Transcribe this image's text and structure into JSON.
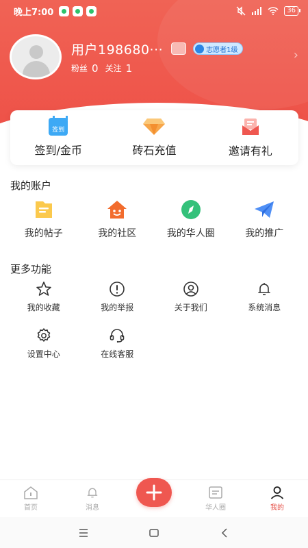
{
  "status_bar": {
    "time": "晚上7:00",
    "battery": "36"
  },
  "profile": {
    "username": "用户198680···",
    "volunteer_badge": "志愿者1级",
    "fans_label": "粉丝",
    "fans_count": "0",
    "follow_label": "关注",
    "follow_count": "1"
  },
  "quick_actions": [
    {
      "label": "签到/金币",
      "icon": "checkin-calendar-icon",
      "icon_text": "签到"
    },
    {
      "label": "砖石充值",
      "icon": "diamond-icon"
    },
    {
      "label": "邀请有礼",
      "icon": "invite-envelope-icon"
    }
  ],
  "my_account": {
    "title": "我的账户",
    "items": [
      {
        "label": "我的帖子",
        "icon": "post-folder-icon"
      },
      {
        "label": "我的社区",
        "icon": "community-house-icon"
      },
      {
        "label": "我的华人圈",
        "icon": "compass-icon"
      },
      {
        "label": "我的推广",
        "icon": "paper-plane-icon"
      }
    ]
  },
  "more_features": {
    "title": "更多功能",
    "items": [
      {
        "label": "我的收藏",
        "icon": "star-icon"
      },
      {
        "label": "我的举报",
        "icon": "alert-circle-icon"
      },
      {
        "label": "关于我们",
        "icon": "user-circle-icon"
      },
      {
        "label": "系统消息",
        "icon": "bell-icon"
      },
      {
        "label": "设置中心",
        "icon": "gear-icon"
      },
      {
        "label": "在线客服",
        "icon": "headset-icon"
      }
    ]
  },
  "bottom_nav": {
    "items": [
      {
        "label": "首页",
        "icon": "home-icon",
        "active": false
      },
      {
        "label": "消息",
        "icon": "bell-icon",
        "active": false
      },
      {
        "label": "",
        "icon": "plus-icon",
        "active": false
      },
      {
        "label": "华人圈",
        "icon": "message-square-icon",
        "active": false
      },
      {
        "label": "我的",
        "icon": "profile-icon",
        "active": true
      }
    ],
    "active_color": "#e4473e",
    "plus_color": "#ef5750"
  },
  "colors": {
    "header": "#ee4f46",
    "accent": "#e4473e"
  }
}
